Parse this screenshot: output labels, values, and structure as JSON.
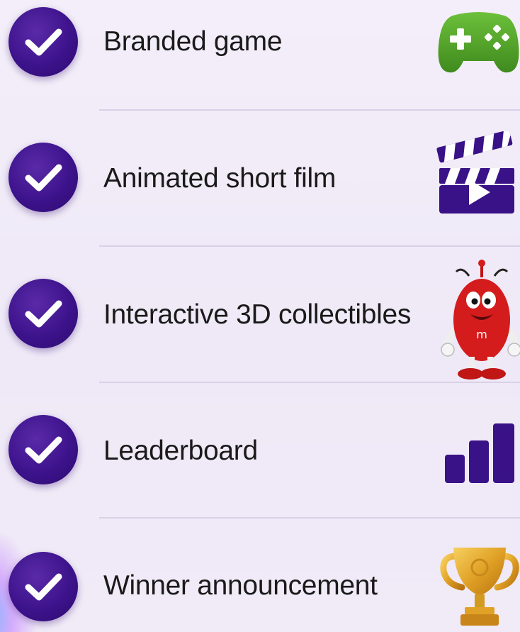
{
  "checklist": {
    "items": [
      {
        "label": "Branded game",
        "icon": "gamepad-icon",
        "checked": true
      },
      {
        "label": "Animated short film",
        "icon": "clapperboard-icon",
        "checked": true
      },
      {
        "label": "Interactive 3D collectibles",
        "icon": "mascot-character-icon",
        "checked": true
      },
      {
        "label": "Leaderboard",
        "icon": "bar-chart-icon",
        "checked": true
      },
      {
        "label": "Winner announcement",
        "icon": "trophy-icon",
        "checked": true
      }
    ]
  },
  "colors": {
    "check_circle": "#3d138c",
    "text": "#1a1a1a",
    "divider": "#d9d1e8",
    "gamepad": "#4f9a2a",
    "purple_icon": "#3a1287",
    "trophy": "#e0a126",
    "mascot": "#d41c1c"
  }
}
